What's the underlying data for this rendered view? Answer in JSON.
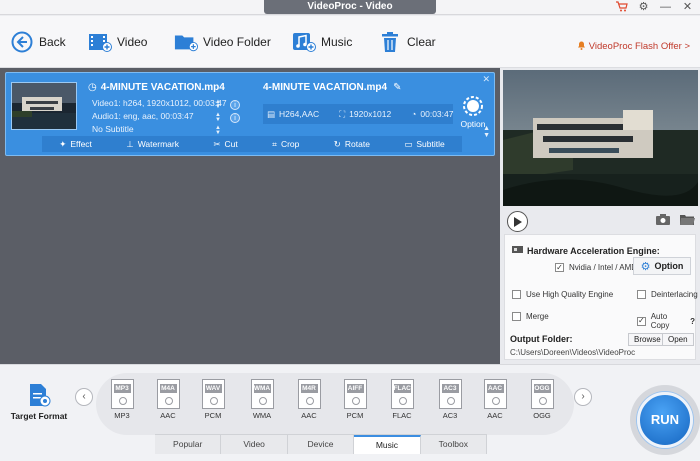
{
  "window": {
    "title": "VideoProc - Video"
  },
  "toolbar": {
    "back_label": "Back",
    "video_label": "Video",
    "folder_label": "Video Folder",
    "music_label": "Music",
    "clear_label": "Clear",
    "flash_offer": "VideoProc Flash Offer >"
  },
  "item": {
    "source_title": "4-MINUTE VACATION.mp4",
    "video_track": "Video1: h264, 1920x1012, 00:03:47",
    "audio_track": "Audio1: eng, aac, 00:03:47",
    "subtitle": "No Subtitle",
    "output_title": "4-MINUTE VACATION.mp4",
    "out_codec": "H264,AAC",
    "out_resolution": "1920x1012",
    "out_duration": "00:03:47",
    "option_label": "Option",
    "codec_badge": "codec"
  },
  "edit_bar": {
    "effect": "Effect",
    "watermark": "Watermark",
    "cut": "Cut",
    "crop": "Crop",
    "rotate": "Rotate",
    "subtitle": "Subtitle"
  },
  "settings": {
    "hw_title": "Hardware Acceleration Engine:",
    "hw_vendor": "Nvidia / Intel / AMD",
    "option_button": "Option",
    "high_quality": "Use High Quality Engine",
    "deinterlacing": "Deinterlacing",
    "merge": "Merge",
    "auto_copy": "Auto Copy",
    "help": "?",
    "output_folder_label": "Output Folder:",
    "output_path": "C:\\Users\\Doreen\\Videos\\VideoProc",
    "browse": "Browse",
    "open": "Open"
  },
  "target_format": {
    "label": "Target Format"
  },
  "formats": [
    {
      "band": "MP3",
      "label": "MP3"
    },
    {
      "band": "M4A",
      "label": "AAC"
    },
    {
      "band": "WAV",
      "label": "PCM"
    },
    {
      "band": "WMA",
      "label": "WMA"
    },
    {
      "band": "M4R",
      "label": "AAC"
    },
    {
      "band": "AIFF",
      "label": "PCM"
    },
    {
      "band": "FLAC",
      "label": "FLAC"
    },
    {
      "band": "AC3",
      "label": "AC3"
    },
    {
      "band": "AAC",
      "label": "AAC"
    },
    {
      "band": "OGG",
      "label": "OGG"
    }
  ],
  "tabs": [
    "Popular",
    "Video",
    "Device",
    "Music",
    "Toolbox"
  ],
  "active_tab": "Music",
  "run_label": "RUN",
  "colors": {
    "accent": "#3a8fe0",
    "run": "#1565c0",
    "offer": "#c0392b"
  }
}
